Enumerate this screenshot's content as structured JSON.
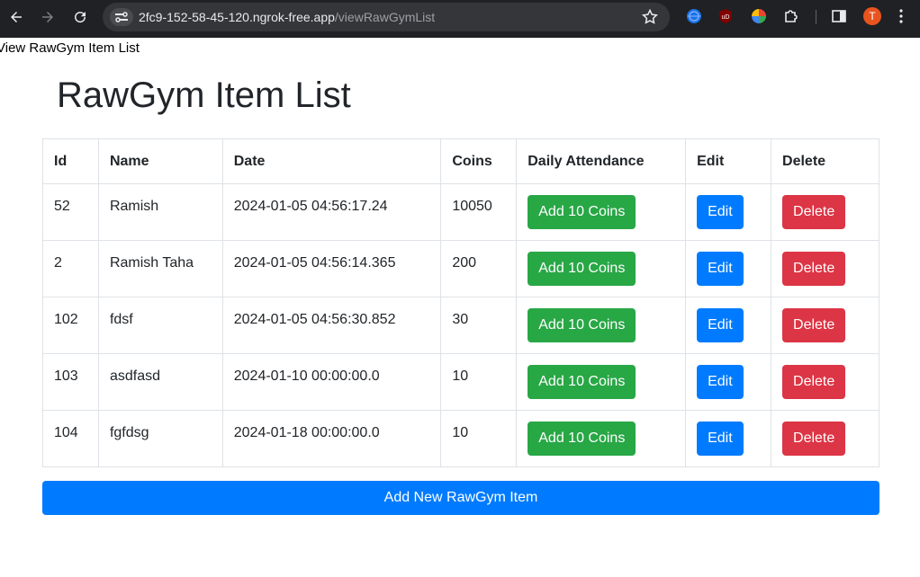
{
  "browser": {
    "url_host": "2fc9-152-58-45-120.ngrok-free.app",
    "url_path": "/viewRawGymList",
    "profile_initial": "T"
  },
  "page": {
    "tab_title": "View RawGym Item List",
    "heading": "RawGym Item List"
  },
  "table": {
    "headers": [
      "Id",
      "Name",
      "Date",
      "Coins",
      "Daily Attendance",
      "Edit",
      "Delete"
    ],
    "rows": [
      {
        "id": "52",
        "name": "Ramish",
        "date": "2024-01-05 04:56:17.24",
        "coins": "10050",
        "attend": "Add 10 Coins",
        "edit": "Edit",
        "delete": "Delete"
      },
      {
        "id": "2",
        "name": "Ramish Taha",
        "date": "2024-01-05 04:56:14.365",
        "coins": "200",
        "attend": "Add 10 Coins",
        "edit": "Edit",
        "delete": "Delete"
      },
      {
        "id": "102",
        "name": "fdsf",
        "date": "2024-01-05 04:56:30.852",
        "coins": "30",
        "attend": "Add 10 Coins",
        "edit": "Edit",
        "delete": "Delete"
      },
      {
        "id": "103",
        "name": "asdfasd",
        "date": "2024-01-10 00:00:00.0",
        "coins": "10",
        "attend": "Add 10 Coins",
        "edit": "Edit",
        "delete": "Delete"
      },
      {
        "id": "104",
        "name": "fgfdsg",
        "date": "2024-01-18 00:00:00.0",
        "coins": "10",
        "attend": "Add 10 Coins",
        "edit": "Edit",
        "delete": "Delete"
      }
    ]
  },
  "actions": {
    "add_new_label": "Add New RawGym Item"
  },
  "colors": {
    "success": "#28a745",
    "primary": "#007bff",
    "danger": "#dc3545"
  }
}
